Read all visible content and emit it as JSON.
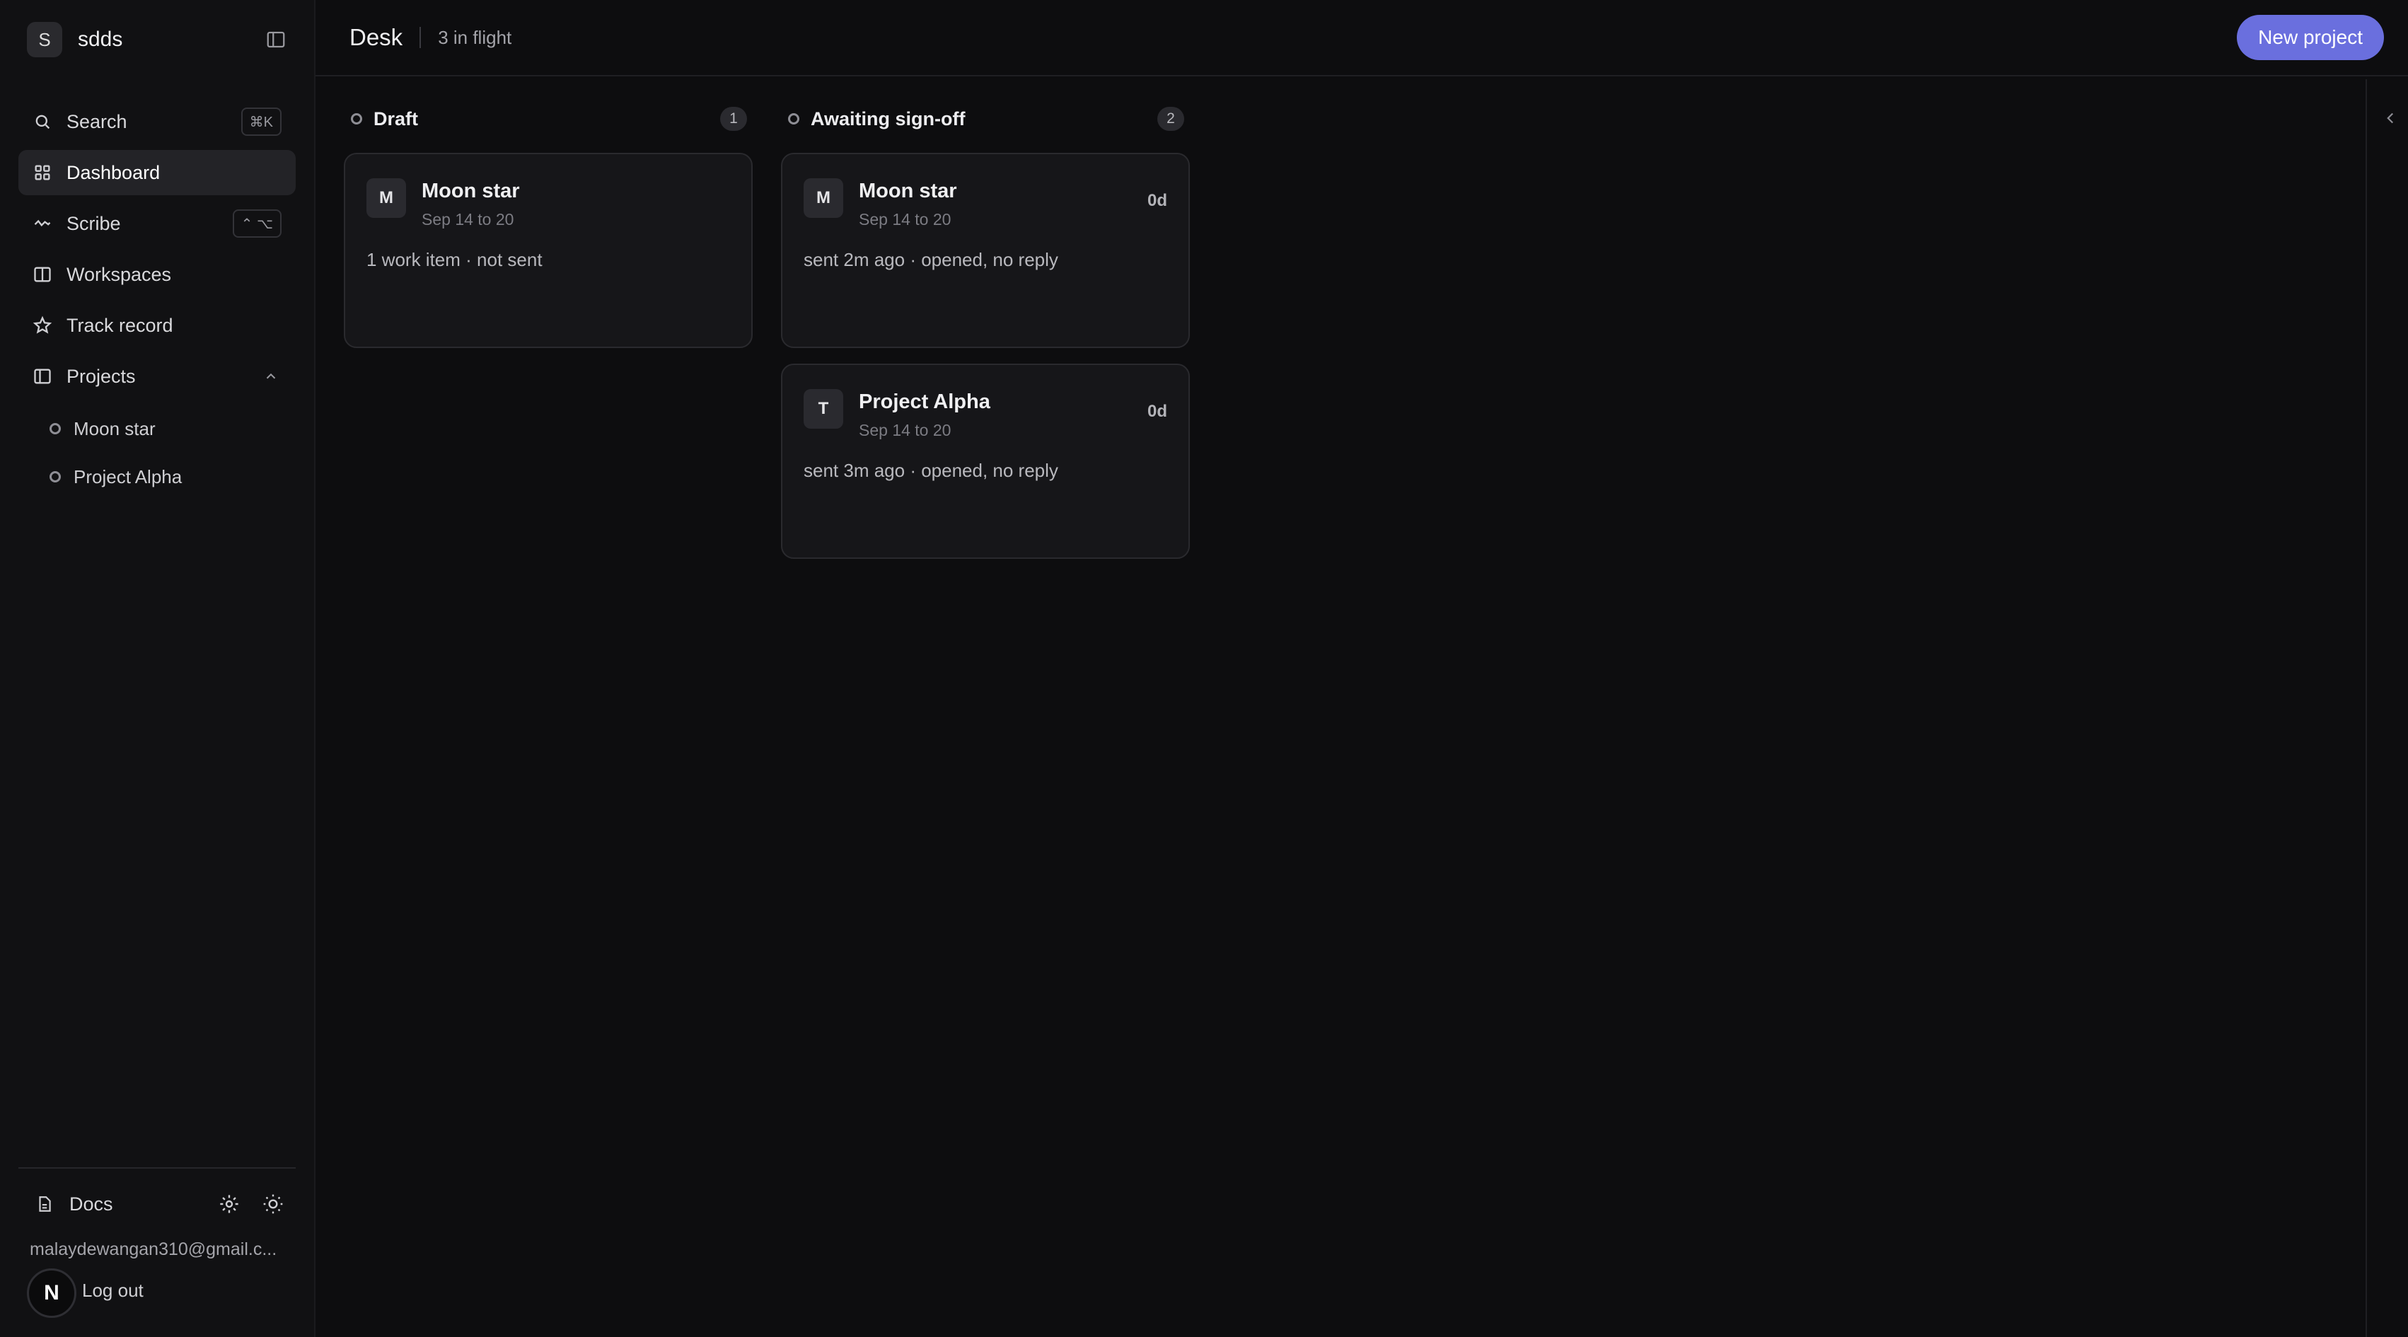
{
  "workspace": {
    "initial": "S",
    "name": "sdds"
  },
  "nav": [
    {
      "label": "Search",
      "icon": "search-icon",
      "shortcut": "⌘K"
    },
    {
      "label": "Dashboard",
      "icon": "grid-icon",
      "active": true
    },
    {
      "label": "Scribe",
      "icon": "wave-icon",
      "shortcut": "⌃ ⌥"
    },
    {
      "label": "Workspaces",
      "icon": "columns-icon"
    },
    {
      "label": "Track record",
      "icon": "star-icon"
    },
    {
      "label": "Projects",
      "icon": "panel-icon",
      "expanded": true
    }
  ],
  "projects": [
    "Moon star",
    "Project Alpha"
  ],
  "footer": {
    "docs_label": "Docs",
    "email": "malaydewangan310@gmail.c...",
    "logout_label": "Log out",
    "badge_letter": "N"
  },
  "header": {
    "title": "Desk",
    "subtitle": "3 in flight",
    "new_button": "New project"
  },
  "columns": [
    {
      "title": "Draft",
      "count": "1",
      "cards": [
        {
          "initial": "M",
          "title": "Moon star",
          "dates": "Sep 14 to 20",
          "age": "",
          "status": "1 work item · not sent"
        }
      ]
    },
    {
      "title": "Awaiting sign-off",
      "count": "2",
      "cards": [
        {
          "initial": "M",
          "title": "Moon star",
          "dates": "Sep 14 to 20",
          "age": "0d",
          "status": "sent 2m ago · opened, no reply"
        },
        {
          "initial": "T",
          "title": "Project Alpha",
          "dates": "Sep 14 to 20",
          "age": "0d",
          "status": "sent 3m ago · opened, no reply"
        }
      ]
    }
  ],
  "colors": {
    "accent": "#6a6fde",
    "background": "#0d0d0f",
    "card": "#161619"
  }
}
